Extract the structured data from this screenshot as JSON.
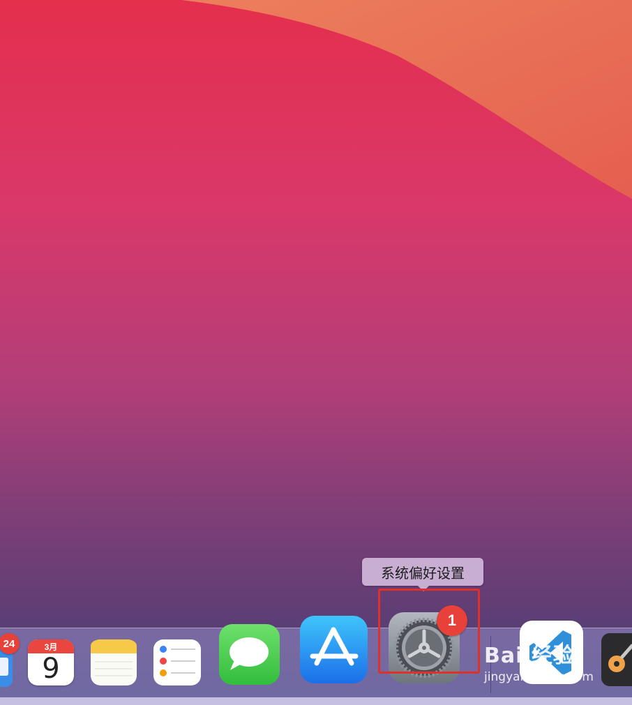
{
  "tooltip": {
    "text": "系统偏好设置"
  },
  "dock": {
    "mail": {
      "name": "Mail",
      "icon": "mail-icon",
      "badge": "24"
    },
    "calendar": {
      "name": "Calendar",
      "icon": "calendar-icon",
      "month": "3月",
      "day": "9"
    },
    "notes": {
      "name": "Notes",
      "icon": "notes-icon"
    },
    "reminders": {
      "name": "Reminders",
      "icon": "reminders-icon"
    },
    "messages": {
      "name": "Messages",
      "icon": "messages-icon"
    },
    "app_store": {
      "name": "App Store",
      "icon": "app-store-icon"
    },
    "system_preferences": {
      "name": "System Preferences",
      "icon": "gear-icon",
      "badge": "1"
    },
    "vscode": {
      "name": "Visual Studio Code",
      "icon": "vscode-icon"
    },
    "keychain": {
      "name": "Keychain Access",
      "icon": "keychain-icon"
    }
  },
  "watermark": {
    "brand": "Bai 经验",
    "url": "jingyan.baidu.com"
  },
  "colors": {
    "highlight": "#e0302a",
    "badge": "#e8413a"
  }
}
